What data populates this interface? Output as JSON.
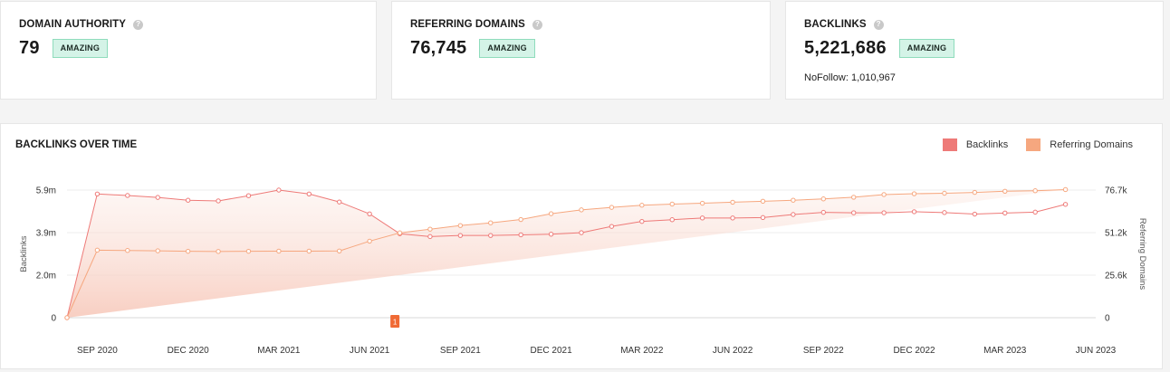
{
  "metrics": [
    {
      "title": "DOMAIN AUTHORITY",
      "value": "79",
      "badge": "AMAZING",
      "sub": ""
    },
    {
      "title": "REFERRING DOMAINS",
      "value": "76,745",
      "badge": "AMAZING",
      "sub": ""
    },
    {
      "title": "BACKLINKS",
      "value": "5,221,686",
      "badge": "AMAZING",
      "sub": "NoFollow: 1,010,967"
    }
  ],
  "help_icon": "question-mark-icon",
  "chart_data": {
    "type": "line",
    "title": "BACKLINKS OVER TIME",
    "legend": [
      "Backlinks",
      "Referring Domains"
    ],
    "legend_position": "top-right",
    "grid": true,
    "x_ticks": [
      "SEP 2020",
      "DEC 2020",
      "MAR 2021",
      "JUN 2021",
      "SEP 2021",
      "DEC 2021",
      "MAR 2022",
      "JUN 2022",
      "SEP 2022",
      "DEC 2022",
      "MAR 2023",
      "JUN 2023"
    ],
    "x": [
      "Aug 2020",
      "Sep 2020",
      "Oct 2020",
      "Nov 2020",
      "Dec 2020",
      "Jan 2021",
      "Feb 2021",
      "Mar 2021",
      "Apr 2021",
      "May 2021",
      "Jun 2021",
      "Jul 2021",
      "Aug 2021",
      "Sep 2021",
      "Oct 2021",
      "Nov 2021",
      "Dec 2021",
      "Jan 2022",
      "Feb 2022",
      "Mar 2022",
      "Apr 2022",
      "May 2022",
      "Jun 2022",
      "Jul 2022",
      "Aug 2022",
      "Sep 2022",
      "Oct 2022",
      "Nov 2022",
      "Dec 2022",
      "Jan 2023",
      "Feb 2023",
      "Mar 2023",
      "Apr 2023",
      "May 2023",
      "Jun 2023"
    ],
    "y_left": {
      "label": "Backlinks",
      "ticks": [
        "0",
        "2.0m",
        "3.9m",
        "5.9m"
      ],
      "tick_values": [
        0,
        1966667,
        3933333,
        5900000
      ],
      "max": 5900000
    },
    "y_right": {
      "label": "Referring Domains",
      "ticks": [
        "0",
        "25.6k",
        "51.2k",
        "76.7k"
      ],
      "tick_values": [
        0,
        25567,
        51133,
        76700
      ],
      "max": 76700
    },
    "series": [
      {
        "name": "Backlinks",
        "axis": "left",
        "color": "#ee7a78",
        "values": [
          0,
          5720000,
          5650000,
          5560000,
          5430000,
          5400000,
          5640000,
          5900000,
          5720000,
          5350000,
          4800000,
          3880000,
          3750000,
          3800000,
          3800000,
          3830000,
          3860000,
          3930000,
          4220000,
          4450000,
          4530000,
          4610000,
          4610000,
          4630000,
          4770000,
          4870000,
          4850000,
          4850000,
          4900000,
          4860000,
          4790000,
          4840000,
          4880000,
          5240000
        ]
      },
      {
        "name": "Referring Domains",
        "axis": "right",
        "color": "#f6a77f",
        "values": [
          0,
          40600,
          40400,
          40200,
          39900,
          39800,
          39900,
          40000,
          40000,
          40100,
          46000,
          51000,
          53200,
          55400,
          57000,
          59000,
          62500,
          64800,
          66300,
          67600,
          68300,
          68800,
          69400,
          70000,
          70600,
          71400,
          72400,
          74000,
          74500,
          74800,
          75300,
          76000,
          76300,
          77000
        ]
      }
    ],
    "annotations": [
      {
        "x": "Jun 2021",
        "label": "1"
      }
    ]
  }
}
